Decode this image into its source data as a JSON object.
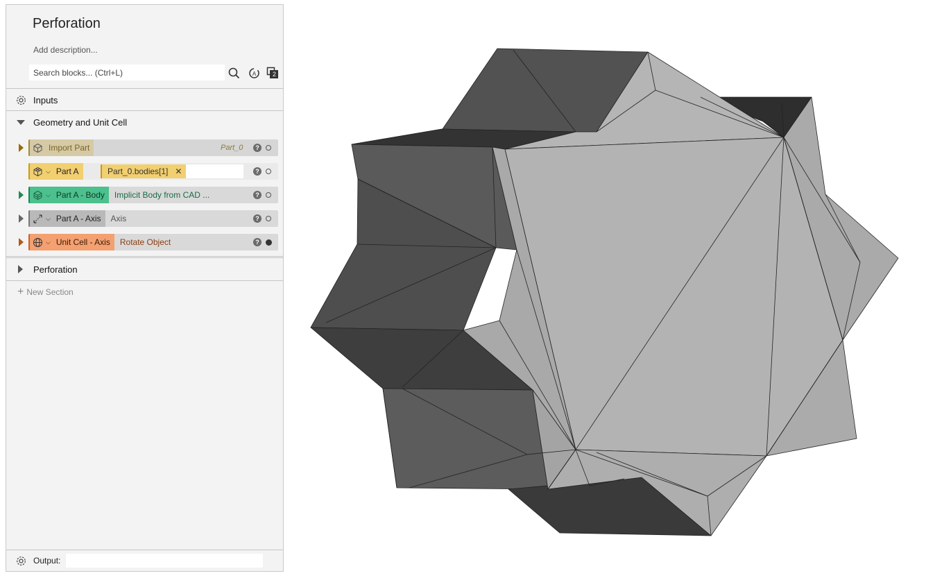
{
  "header": {
    "title": "Perforation",
    "description_placeholder": "Add description...",
    "search_placeholder": "Search blocks... (Ctrl+L)",
    "layers_count": "2"
  },
  "sections": {
    "inputs": "Inputs",
    "geometry": "Geometry and Unit Cell",
    "perforation": "Perforation",
    "new_section": "New Section"
  },
  "blocks": [
    {
      "label": "Import Part",
      "value": "Part_0",
      "color": "#d6c9a5",
      "state": "open"
    },
    {
      "label": "Part A",
      "chip": "Part_0.bodies[1]",
      "color": "#f2cf6f",
      "state": "open"
    },
    {
      "label": "Part A - Body",
      "value": "Implicit Body from CAD ...",
      "color": "#4cc08e",
      "state": "open"
    },
    {
      "label": "Part A - Axis",
      "value": "Axis",
      "color": "#b9b9b9",
      "state": "open"
    },
    {
      "label": "Unit Cell - Axis",
      "value": "Rotate Object",
      "color": "#f4a070",
      "state": "filled"
    }
  ],
  "footer": {
    "output_label": "Output:"
  },
  "colors": {
    "panel_bg": "#f3f3f3",
    "mesh_light": "#b3b3b3",
    "mesh_dark": "#555555"
  }
}
